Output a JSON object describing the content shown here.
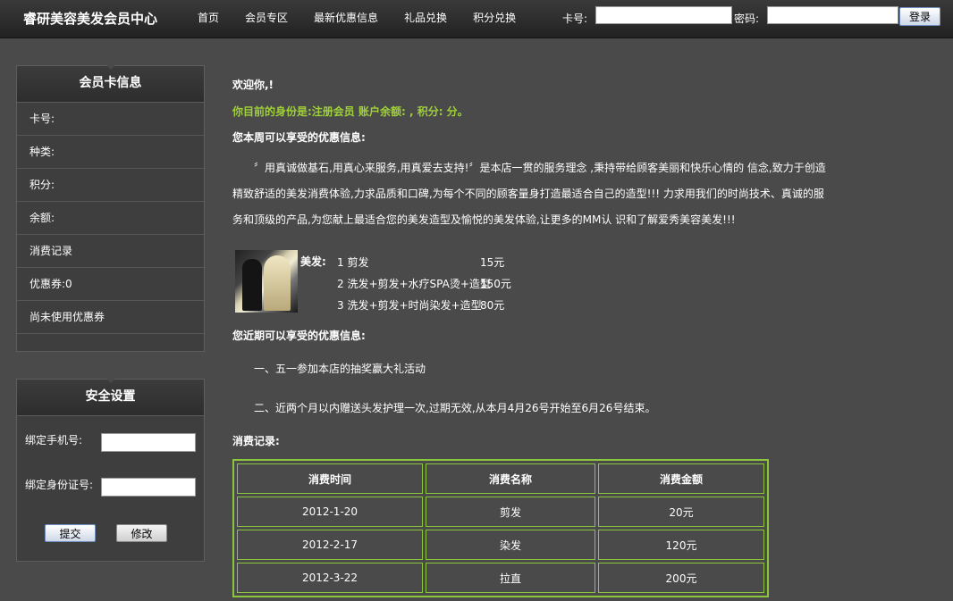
{
  "header": {
    "brand": "睿研美容美发会员中心",
    "nav": [
      "首页",
      "会员专区",
      "最新优惠信息",
      "礼品兑换",
      "积分兑换"
    ],
    "card_label": "卡号:",
    "password_label": "密码:",
    "login_button": "登录"
  },
  "card_panel": {
    "title": "会员卡信息",
    "rows": [
      "卡号:",
      "种类:",
      "积分:",
      "余额:",
      "消费记录",
      "优惠券:0",
      "尚未使用优惠券"
    ]
  },
  "security_panel": {
    "title": "安全设置",
    "phone_label": "绑定手机号:",
    "id_label": "绑定身份证号:",
    "submit_button": "提交",
    "modify_button": "修改"
  },
  "main": {
    "welcome": "欢迎你,!",
    "status": "你目前的身份是:注册会员 账户余额: , 积分: 分。",
    "weekly_title": "您本周可以享受的优惠信息:",
    "intro": "〞用真诚做基石,用真心来服务,用真爱去支持!〞是本店一贯的服务理念 ,秉持带给顾客美丽和快乐心情的 信念,致力于创造精致舒适的美发消费体验,力求品质和口碑,为每个不同的顾客量身打造最适合自己的造型!!! 力求用我们的时尚技术、真诚的服务和顶级的产品,为您献上最适合您的美发造型及愉悦的美发体验,让更多的MM认 识和了解爱秀美容美发!!!",
    "promo_label": "美发:",
    "services": [
      {
        "name": "1 剪发",
        "price": "15元"
      },
      {
        "name": "2 洗发+剪发+水疗SPA烫+造型",
        "price": "150元"
      },
      {
        "name": "3 洗发+剪发+时尚染发+造型",
        "price": "80元"
      }
    ],
    "recent_title": "您近期可以享受的优惠信息:",
    "recent_items": [
      "一、五一参加本店的抽奖赢大礼活动",
      "二、近两个月以内赠送头发护理一次,过期无效,从本月4月26号开始至6月26号结束。"
    ],
    "records_title": "消费记录:",
    "table": {
      "headers": [
        "消费时间",
        "消费名称",
        "消费金额"
      ],
      "rows": [
        [
          "2012-1-20",
          "剪发",
          "20元"
        ],
        [
          "2012-2-17",
          "染发",
          "120元"
        ],
        [
          "2012-3-22",
          "拉直",
          "200元"
        ]
      ]
    }
  },
  "colors": {
    "background": "#4a4a4a",
    "accent_green": "#9fd03a",
    "table_border": "#8cc63f"
  }
}
